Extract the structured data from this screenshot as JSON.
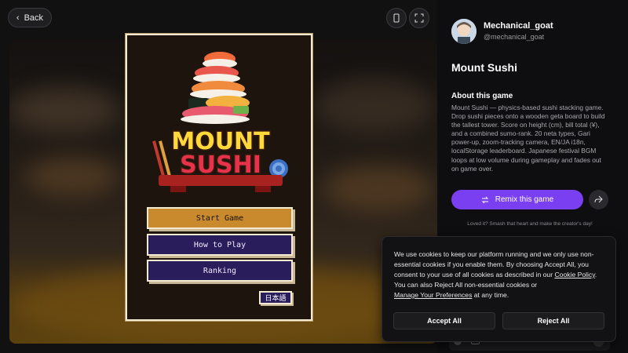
{
  "topbar": {
    "back_label": "Back",
    "back_icon": "chevron-left-icon",
    "device_icon": "mobile-device-icon",
    "fullscreen_icon": "expand-icon"
  },
  "game": {
    "logo_line1": "MOUNT",
    "logo_line2": "SUSHI",
    "menu": [
      "Start Game",
      "How to Play",
      "Ranking"
    ],
    "lang_button": "日本語",
    "colors": {
      "start": "#c98a2e",
      "menu": "#2a1d5c",
      "frame": "#f4ead2"
    }
  },
  "sidebar": {
    "username": "Mechanical_goat",
    "handle": "@mechanical_goat",
    "title": "Mount Sushi",
    "about_heading": "About this game",
    "about_text": "Mount Sushi — physics-based sushi stacking game. Drop sushi pieces onto a wooden geta board to build the tallest tower. Score on height (cm), bill total (¥), and a combined sumo-rank. 20 neta types, Gari power-up, zoom-tracking camera, EN/JA i18n, localStorage leaderboard. Japanese festival BGM loops at low volume during gameplay and fades out on game over.",
    "remix_label": "Remix this game",
    "remix_icon": "swap-arrows-icon",
    "share_icon": "share-icon",
    "loved_text": "Loved it? Smash that heart and make the creator's day!",
    "accent": "#7b3ff2"
  },
  "cookie": {
    "text_a": "We use cookies to keep our platform running and we only use non-essential cookies if you enable them. By choosing Accept All, you consent to your use of all cookies as described in our",
    "policy_link": "Cookie Policy",
    "text_b": ". You can also Reject All non-essential cookies or",
    "prefs_link": "Manage Your Preferences",
    "text_c": "at any time.",
    "accept_label": "Accept All",
    "reject_label": "Reject All"
  }
}
